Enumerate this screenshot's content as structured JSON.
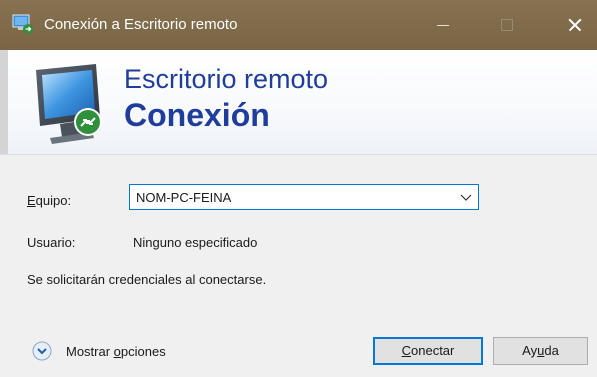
{
  "window": {
    "title": "Conexión a Escritorio remoto",
    "accent": "#7f6a49"
  },
  "banner": {
    "line1": "Escritorio remoto",
    "line2": "Conexión",
    "icon": "remote-desktop-monitor-icon",
    "text_color": "#1f3d9a"
  },
  "form": {
    "computer": {
      "label_pre": "",
      "label_mnemonic": "E",
      "label_post": "quipo:",
      "value": "NOM-PC-FEINA"
    },
    "user": {
      "label": "Usuario:",
      "value": "Ninguno especificado"
    },
    "note": "Se solicitarán credenciales al conectarse."
  },
  "footer": {
    "options": {
      "label_pre": "Mostrar ",
      "label_mnemonic": "o",
      "label_post": "pciones"
    },
    "connect": {
      "label_pre": "",
      "label_mnemonic": "C",
      "label_post": "onectar"
    },
    "help": {
      "label_pre": "Ay",
      "label_mnemonic": "u",
      "label_post": "da"
    }
  }
}
